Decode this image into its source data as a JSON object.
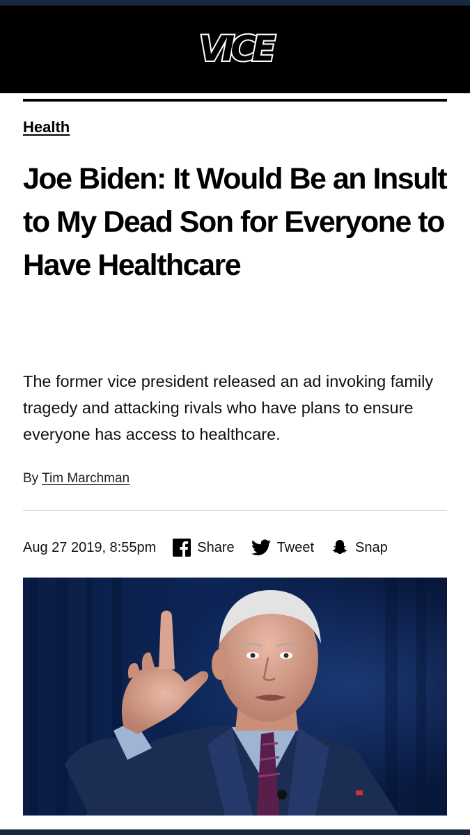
{
  "brand": {
    "logo_text": "VICE"
  },
  "article": {
    "category": "Health",
    "headline": "Joe Biden: It Would Be an Insult to My Dead Son for Everyone to Have Healthcare",
    "dek": "The former vice president released an ad invoking family tragedy and attacking rivals who have plans to ensure everyone has access to healthcare.",
    "byline_prefix": "By",
    "author": "Tim Marchman",
    "date": "Aug 27 2019, 8:55pm"
  },
  "share": {
    "facebook_label": "Share",
    "twitter_label": "Tweet",
    "snapchat_label": "Snap"
  },
  "icons": {
    "facebook": "facebook-icon",
    "twitter": "twitter-icon",
    "snapchat": "snapchat-icon"
  },
  "colors": {
    "header_bg": "#000000",
    "text": "#000000",
    "outer_frame": "#1a2740"
  }
}
